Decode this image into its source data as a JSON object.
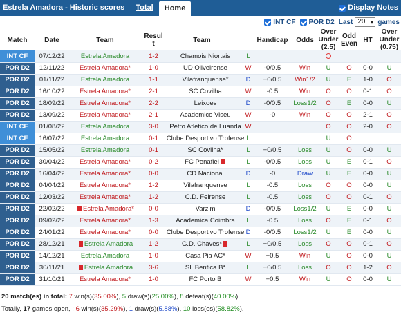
{
  "header": {
    "title": "Estrela Amadora - Historic scores",
    "tab_total": "Total",
    "tab_home": "Home",
    "display_notes": "Display Notes"
  },
  "filters": {
    "int_cf": "INT CF",
    "por_d2": "POR D2",
    "last_label": "Last",
    "last_value": "20",
    "games_label": "games"
  },
  "columns": {
    "match": "Match",
    "date": "Date",
    "team": "Team",
    "result_line1": "Resul",
    "result_line2": "t",
    "team2": "Team",
    "handicap": "Handicap",
    "odds": "Odds",
    "ou1": "Over",
    "ou2": "Under",
    "ou3": "(2.5)",
    "oe1": "Odd",
    "oe2": "Even",
    "ht": "HT",
    "ou075_1": "Over",
    "ou075_2": "Under",
    "ou075_3": "(0.75)"
  },
  "colors": {
    "int_cf": "#3f8fd8",
    "por_d2": "#2f5f8f"
  },
  "rows": [
    {
      "comp": "INT CF",
      "date": "07/12/22",
      "home": "Estrela Amadora",
      "home_star": false,
      "home_red": false,
      "score": "1-2",
      "away": "Chamois Niortais",
      "away_red": false,
      "res": "L",
      "hcap": "",
      "odds": "",
      "ou": "",
      "oe": "",
      "ht": "",
      "ou075": ""
    },
    {
      "comp": "POR D2",
      "date": "12/11/22",
      "home": "Estrela Amadora*",
      "home_star": true,
      "home_red": false,
      "score": "1-0",
      "away": "UD Oliveirense",
      "away_red": false,
      "res": "W",
      "hcap": "-0/0.5",
      "odds": "Win",
      "ou": "U",
      "oe": "O",
      "ht": "0-0",
      "ou075": "U"
    },
    {
      "comp": "POR D2",
      "date": "01/11/22",
      "home": "Estrela Amadora",
      "home_star": false,
      "home_red": false,
      "score": "1-1",
      "away": "Vilafranquense*",
      "away_red": false,
      "res": "D",
      "hcap": "+0/0.5",
      "odds": "Win1/2",
      "ou": "U",
      "oe": "E",
      "ht": "1-0",
      "ou075": "O"
    },
    {
      "comp": "POR D2",
      "date": "16/10/22",
      "home": "Estrela Amadora*",
      "home_star": true,
      "home_red": false,
      "score": "2-1",
      "away": "SC Covilha",
      "away_red": false,
      "res": "W",
      "hcap": "-0.5",
      "odds": "Win",
      "ou": "O",
      "oe": "O",
      "ht": "0-1",
      "ou075": "O"
    },
    {
      "comp": "POR D2",
      "date": "18/09/22",
      "home": "Estrela Amadora*",
      "home_star": true,
      "home_red": false,
      "score": "2-2",
      "away": "Leixoes",
      "away_red": false,
      "res": "D",
      "hcap": "-0/0.5",
      "odds": "Loss1/2",
      "ou": "O",
      "oe": "E",
      "ht": "0-0",
      "ou075": "U"
    },
    {
      "comp": "POR D2",
      "date": "13/09/22",
      "home": "Estrela Amadora*",
      "home_star": true,
      "home_red": false,
      "score": "2-1",
      "away": "Academico Viseu",
      "away_red": false,
      "res": "W",
      "hcap": "-0",
      "odds": "Win",
      "ou": "O",
      "oe": "O",
      "ht": "2-1",
      "ou075": "O"
    },
    {
      "comp": "INT CF",
      "date": "01/08/22",
      "home": "Estrela Amadora",
      "home_star": false,
      "home_red": false,
      "score": "3-0",
      "away": "Petro Atletico de Luanda",
      "away_red": false,
      "res": "W",
      "hcap": "",
      "odds": "",
      "ou": "O",
      "oe": "O",
      "ht": "2-0",
      "ou075": "O"
    },
    {
      "comp": "INT CF",
      "date": "16/07/22",
      "home": "Estrela Amadora",
      "home_star": false,
      "home_red": false,
      "score": "0-1",
      "away": "Clube Desportivo Trofense",
      "away_red": false,
      "res": "L",
      "hcap": "",
      "odds": "",
      "ou": "U",
      "oe": "O",
      "ht": "",
      "ou075": ""
    },
    {
      "comp": "POR D2",
      "date": "15/05/22",
      "home": "Estrela Amadora",
      "home_star": false,
      "home_red": false,
      "score": "0-1",
      "away": "SC Covilha*",
      "away_red": false,
      "res": "L",
      "hcap": "+0/0.5",
      "odds": "Loss",
      "ou": "U",
      "oe": "O",
      "ht": "0-0",
      "ou075": "U"
    },
    {
      "comp": "POR D2",
      "date": "30/04/22",
      "home": "Estrela Amadora*",
      "home_star": true,
      "home_red": false,
      "score": "0-2",
      "away": "FC Penafiel",
      "away_red": true,
      "res": "L",
      "hcap": "-0/0.5",
      "odds": "Loss",
      "ou": "U",
      "oe": "E",
      "ht": "0-1",
      "ou075": "O"
    },
    {
      "comp": "POR D2",
      "date": "16/04/22",
      "home": "Estrela Amadora*",
      "home_star": true,
      "home_red": false,
      "score": "0-0",
      "away": "CD Nacional",
      "away_red": false,
      "res": "D",
      "hcap": "-0",
      "odds": "Draw",
      "ou": "U",
      "oe": "E",
      "ht": "0-0",
      "ou075": "U"
    },
    {
      "comp": "POR D2",
      "date": "04/04/22",
      "home": "Estrela Amadora*",
      "home_star": true,
      "home_red": false,
      "score": "1-2",
      "away": "Vilafranquense",
      "away_red": false,
      "res": "L",
      "hcap": "-0.5",
      "odds": "Loss",
      "ou": "O",
      "oe": "O",
      "ht": "0-0",
      "ou075": "U"
    },
    {
      "comp": "POR D2",
      "date": "12/03/22",
      "home": "Estrela Amadora*",
      "home_star": true,
      "home_red": false,
      "score": "1-2",
      "away": "C.D. Feirense",
      "away_red": false,
      "res": "L",
      "hcap": "-0.5",
      "odds": "Loss",
      "ou": "O",
      "oe": "O",
      "ht": "0-1",
      "ou075": "O"
    },
    {
      "comp": "POR D2",
      "date": "22/02/22",
      "home": "Estrela Amadora*",
      "home_star": true,
      "home_red": true,
      "score": "0-0",
      "away": "Varzim",
      "away_red": false,
      "res": "D",
      "hcap": "-0/0.5",
      "odds": "Loss1/2",
      "ou": "U",
      "oe": "E",
      "ht": "0-0",
      "ou075": "U"
    },
    {
      "comp": "POR D2",
      "date": "09/02/22",
      "home": "Estrela Amadora*",
      "home_star": true,
      "home_red": false,
      "score": "1-3",
      "away": "Academica Coimbra",
      "away_red": false,
      "res": "L",
      "hcap": "-0.5",
      "odds": "Loss",
      "ou": "O",
      "oe": "E",
      "ht": "0-1",
      "ou075": "O"
    },
    {
      "comp": "POR D2",
      "date": "24/01/22",
      "home": "Estrela Amadora*",
      "home_star": true,
      "home_red": false,
      "score": "0-0",
      "away": "Clube Desportivo Trofense",
      "away_red": false,
      "res": "D",
      "hcap": "-0/0.5",
      "odds": "Loss1/2",
      "ou": "U",
      "oe": "E",
      "ht": "0-0",
      "ou075": "U"
    },
    {
      "comp": "POR D2",
      "date": "28/12/21",
      "home": "Estrela Amadora",
      "home_star": false,
      "home_red": true,
      "score": "1-2",
      "away": "G.D. Chaves*",
      "away_red": true,
      "res": "L",
      "hcap": "+0/0.5",
      "odds": "Loss",
      "ou": "O",
      "oe": "O",
      "ht": "0-1",
      "ou075": "O"
    },
    {
      "comp": "POR D2",
      "date": "14/12/21",
      "home": "Estrela Amadora",
      "home_star": false,
      "home_red": false,
      "score": "1-0",
      "away": "Casa Pia AC*",
      "away_red": false,
      "res": "W",
      "hcap": "+0.5",
      "odds": "Win",
      "ou": "U",
      "oe": "O",
      "ht": "0-0",
      "ou075": "U"
    },
    {
      "comp": "POR D2",
      "date": "30/11/21",
      "home": "Estrela Amadora",
      "home_star": false,
      "home_red": true,
      "score": "3-6",
      "away": "SL Benfica B*",
      "away_red": false,
      "res": "L",
      "hcap": "+0/0.5",
      "odds": "Loss",
      "ou": "O",
      "oe": "O",
      "ht": "1-2",
      "ou075": "O"
    },
    {
      "comp": "POR D2",
      "date": "31/10/21",
      "home": "Estrela Amadora*",
      "home_star": true,
      "home_red": false,
      "score": "1-0",
      "away": "FC Porto B",
      "away_red": false,
      "res": "W",
      "hcap": "+0.5",
      "odds": "Win",
      "ou": "U",
      "oe": "O",
      "ht": "0-0",
      "ou075": "U"
    }
  ],
  "summary": {
    "line1_a": "20 match(es) in total: ",
    "line1_wins": "7",
    "line1_b": " win(s)(",
    "line1_wpct": "35.00%",
    "line1_c": "), ",
    "line1_draws": "5",
    "line1_d": " draw(s)(",
    "line1_dpct": "25.00%",
    "line1_e": "), ",
    "line1_losses": "8",
    "line1_f": " defeat(s)(",
    "line1_lpct": "40.00%",
    "line1_g": ").",
    "line2_a": "Totally, ",
    "line2_games": "17",
    "line2_b": " games open, : ",
    "line2_wins": "6",
    "line2_c": " win(s)(",
    "line2_wpct": "35.29%",
    "line2_d": "), ",
    "line2_draws": "1",
    "line2_e": " draw(s)(",
    "line2_dpct": "5.88%",
    "line2_f": "), ",
    "line2_losses": "10",
    "line2_g": " loss(es)(",
    "line2_lpct": "58.82%",
    "line2_h": ")."
  }
}
